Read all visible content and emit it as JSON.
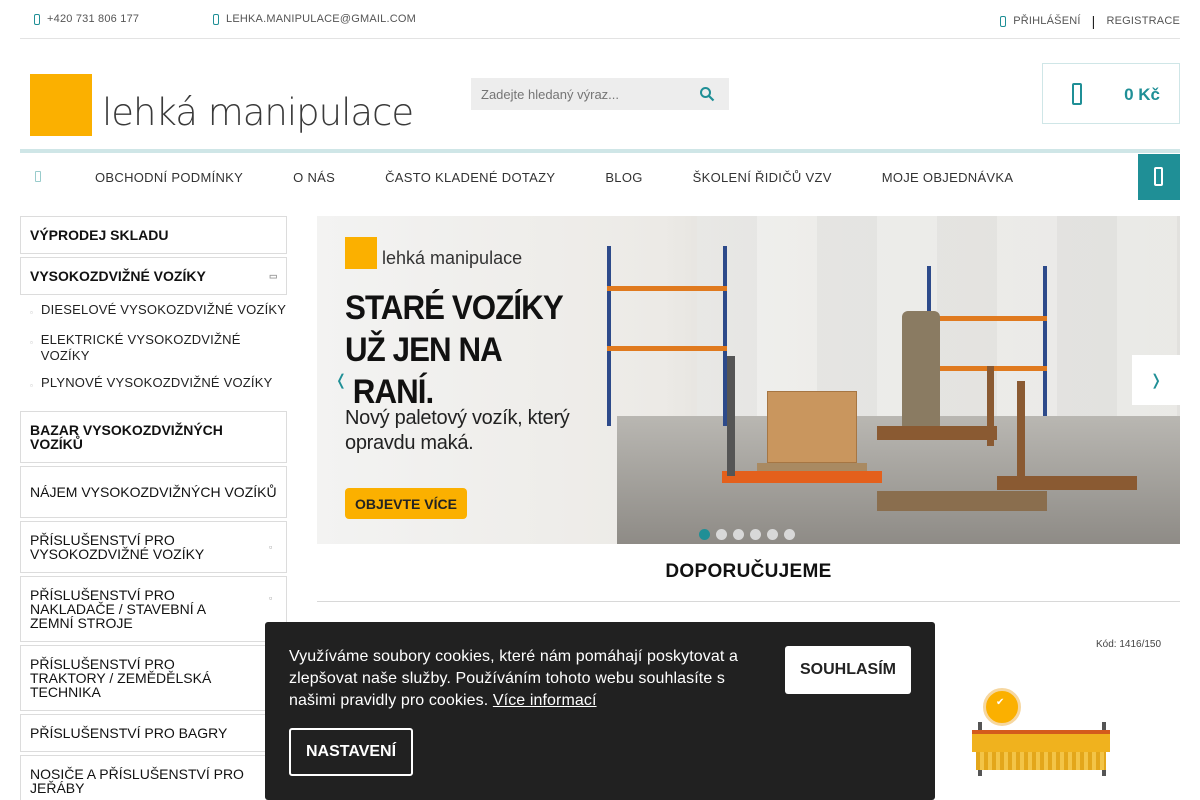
{
  "topbar": {
    "phone": "+420 731 806 177",
    "email": "LEHKA.MANIPULACE@GMAIL.COM",
    "login": "PŘIHLÁŠENÍ",
    "separator": "|",
    "register": "REGISTRACE"
  },
  "header": {
    "logo_text": "lehká manipulace",
    "search_placeholder": "Zadejte hledaný výraz...",
    "cart_price": "0 Kč"
  },
  "nav": {
    "items": [
      "OBCHODNÍ PODMÍNKY",
      "O NÁS",
      "ČASTO KLADENÉ DOTAZY",
      "BLOG",
      "ŠKOLENÍ ŘIDIČŮ VZV",
      "MOJE OBJEDNÁVKA"
    ]
  },
  "sidebar": {
    "sale": "VÝPRODEJ SKLADU",
    "forklifts": "VYSOKOZDVIŽNÉ VOZÍKY",
    "forklift_subs": [
      "DIESELOVÉ VYSOKOZDVIŽNÉ VOZÍKY",
      "ELEKTRICKÉ VYSOKOZDVIŽNÉ VOZÍKY",
      "PLYNOVÉ VYSOKOZDVIŽNÉ VOZÍKY"
    ],
    "bazar": "BAZAR VYSOKOZDVIŽNÝCH VOZÍKŮ",
    "rental": "NÁJEM VYSOKOZDVIŽNÝCH VOZÍKŮ",
    "acc_forklifts": "PŘÍSLUŠENSTVÍ PRO VYSOKOZDVIŽNÉ VOZÍKY",
    "acc_loaders": "PŘÍSLUŠENSTVÍ PRO NAKLADAČE / STAVEBNÍ A ZEMNÍ STROJE",
    "acc_tractors": "PŘÍSLUŠENSTVÍ PRO TRAKTORY / ZEMĚDĚLSKÁ TECHNIKA",
    "acc_excavators": "PŘÍSLUŠENSTVÍ PRO BAGRY",
    "cranes": "NOSIČE A PŘÍSLUŠENSTVÍ PRO JEŘÁBY"
  },
  "banner": {
    "logo_text": "lehká manipulace",
    "title": "STARÉ VOZÍKY UŽ JEN NA ŠROT. ... RANÍ.",
    "title_visible": "STARÉ VOZÍKY UŽ JEN NA  RANÍ.",
    "subtitle": "Nový paletový vozík, který opravdu maká.",
    "cta": "OBJEVTE VÍCE",
    "slide_count": 6,
    "active_slide": 1
  },
  "recommend": {
    "title": "DOPORUČUJEME",
    "product_code": "Kód: 1416/150"
  },
  "cookie": {
    "text": "Využíváme soubory cookies, které nám pomáhají poskytovat a zlepšovat naše služby. Používáním tohoto webu souhlasíte s našimi pravidly pro cookies.",
    "more_link": "Více informací",
    "agree": "SOUHLASÍM",
    "settings": "NASTAVENÍ"
  },
  "colors": {
    "accent": "#1f8f96",
    "brand_yellow": "#fbb000",
    "cookie_bg": "#212121"
  }
}
